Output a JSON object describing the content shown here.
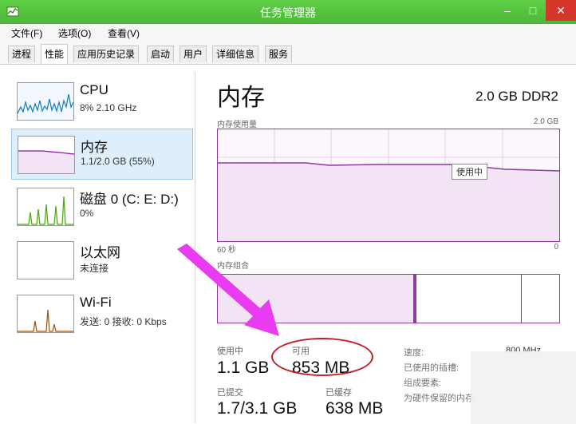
{
  "window": {
    "title": "任务管理器",
    "minimize_glyph": "–",
    "maximize_glyph": "□",
    "close_glyph": "✕"
  },
  "menu": {
    "items": [
      "文件(F)",
      "选项(O)",
      "查看(V)"
    ]
  },
  "tabs": {
    "items": [
      "进程",
      "性能",
      "应用历史记录",
      "启动",
      "用户",
      "详细信息",
      "服务"
    ],
    "active": "性能"
  },
  "resources": [
    {
      "name": "CPU",
      "detail": "8% 2.10 GHz",
      "color": "#117dbb"
    },
    {
      "name": "内存",
      "detail": "1.1/2.0 GB (55%)",
      "color": "#8b12ae",
      "selected": true
    },
    {
      "name": "磁盘 0 (C: E: D:)",
      "detail": "0%",
      "color": "#4da60c"
    },
    {
      "name": "以太网",
      "detail": "未连接",
      "color": "#a74f01"
    },
    {
      "name": "Wi-Fi",
      "detail": "发送: 0 接收: 0 Kbps",
      "color": "#a74f01"
    }
  ],
  "memory": {
    "title": "内存",
    "spec": "2.0 GB DDR2",
    "usage_graph_label": "内存使用量",
    "usage_graph_max": "2.0 GB",
    "time_span": "60 秒",
    "time_end": "0",
    "in_use_tag": "使用中",
    "composition_label": "内存组合",
    "usage_fraction": 0.55,
    "stats": {
      "in_use_label": "使用中",
      "in_use_value": "1.1 GB",
      "available_label": "可用",
      "available_value": "853 MB",
      "committed_label": "已提交",
      "committed_value": "1.7/3.1 GB",
      "cached_label": "已缓存",
      "cached_value": "638 MB"
    },
    "side": {
      "speed_label": "速度:",
      "speed_value": "800 MHz",
      "slots_label": "已使用的插槽:",
      "form_factor_label": "组成要素:",
      "hardware_reserved_label": "为硬件保留的内存:"
    },
    "colors": {
      "accent": "#8b3d9e",
      "graph_fill": "#f2e4f4"
    }
  },
  "annotations": {
    "arrow_color": "#e93cf0",
    "ellipse_color": "#c21f28"
  }
}
